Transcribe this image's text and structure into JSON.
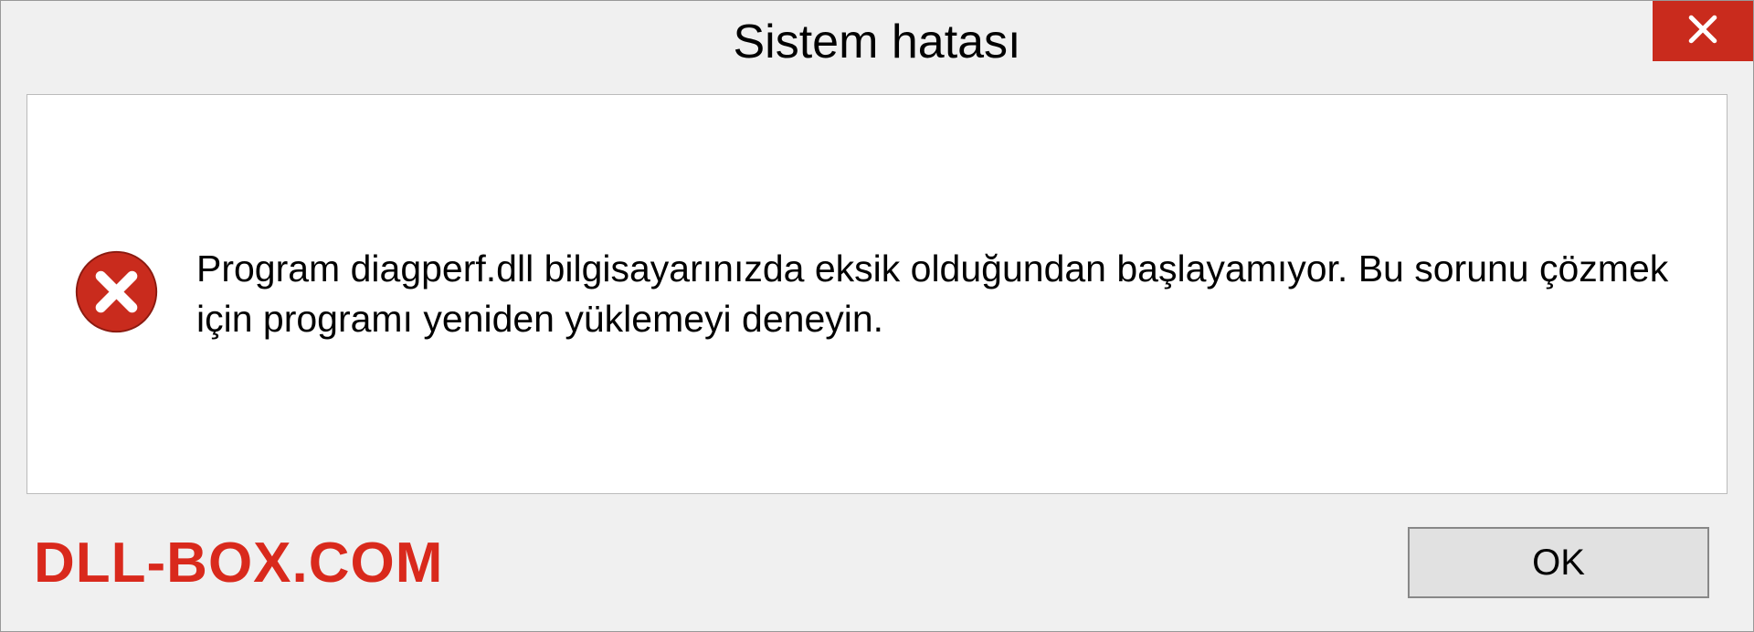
{
  "dialog": {
    "title": "Sistem hatası",
    "message": "Program diagperf.dll bilgisayarınızda eksik olduğundan başlayamıyor. Bu sorunu çözmek için programı yeniden yüklemeyi deneyin.",
    "ok_label": "OK"
  },
  "watermark": "DLL-BOX.COM",
  "colors": {
    "close_bg": "#c92b1d",
    "error_icon": "#c92b1d",
    "watermark": "#d9291c"
  }
}
